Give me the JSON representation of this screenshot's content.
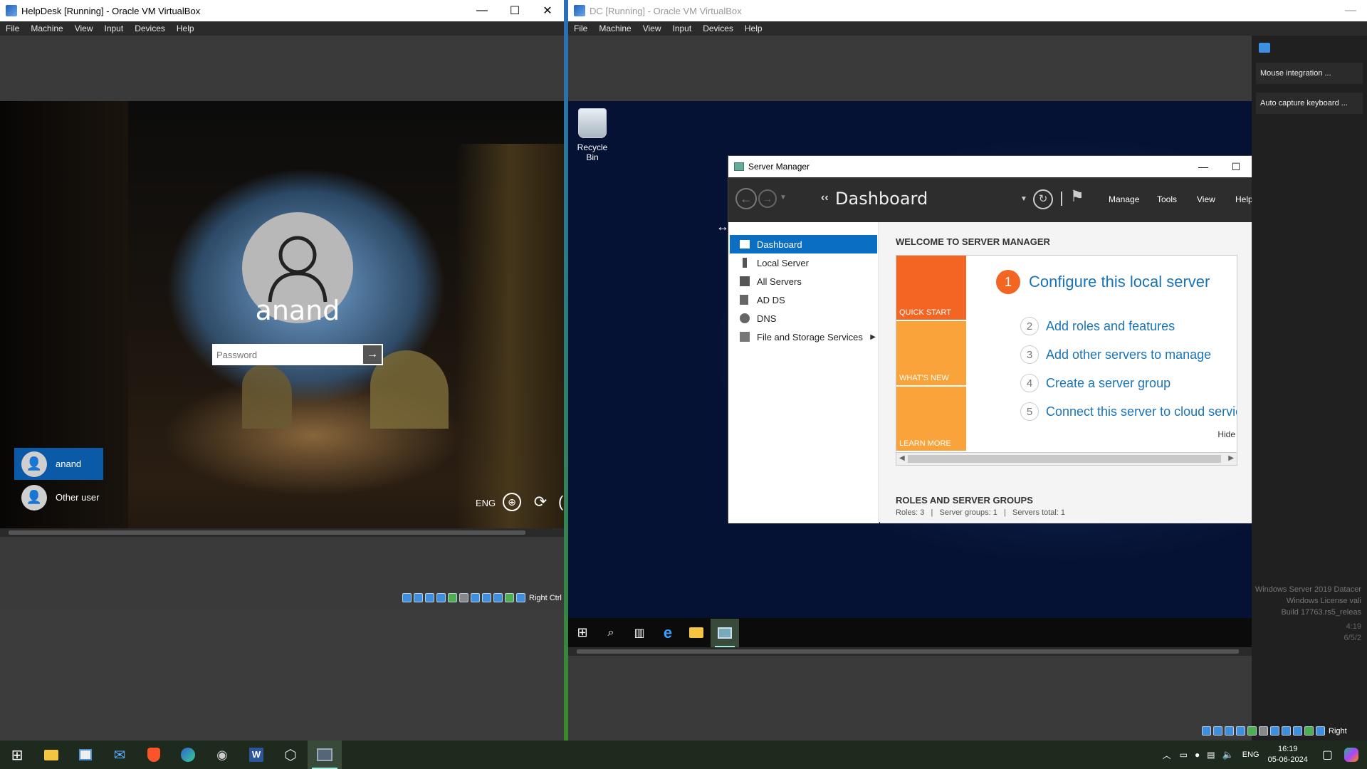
{
  "left_window": {
    "title": "HelpDesk [Running] - Oracle VM VirtualBox",
    "menu": [
      "File",
      "Machine",
      "Input",
      "View",
      "Devices",
      "Help"
    ],
    "menu_order": [
      "File",
      "Machine",
      "View",
      "Input",
      "Devices",
      "Help"
    ],
    "controls": {
      "minimize": "—",
      "maximize": "☐",
      "close": "✕"
    },
    "login": {
      "username": "anand",
      "password_placeholder": "Password",
      "users": [
        {
          "name": "anand",
          "selected": true
        },
        {
          "name": "Other user",
          "selected": false
        }
      ],
      "lang": "ENG"
    },
    "status_host_key": "Right Ctrl"
  },
  "right_window": {
    "title": "DC [Running] - Oracle VM VirtualBox",
    "menu": [
      "File",
      "Machine",
      "View",
      "Input",
      "Devices",
      "Help"
    ],
    "desktop": {
      "recycle_bin_label": "Recycle Bin",
      "watermark": [
        "Windows Server 2019 Datacer",
        "Windows License vali",
        "Build 17763.rs5_releas"
      ],
      "clock": [
        "4:19",
        "6/5/2"
      ]
    },
    "popup": {
      "items": [
        "Mouse integration ...",
        "Auto capture keyboard ..."
      ]
    },
    "server_manager": {
      "title": "Server Manager",
      "breadcrumb_arrows": "‹‹",
      "page_title": "Dashboard",
      "menus": [
        "Manage",
        "Tools",
        "View",
        "Help"
      ],
      "nav": [
        {
          "label": "Dashboard",
          "selected": true
        },
        {
          "label": "Local Server",
          "selected": false
        },
        {
          "label": "All Servers",
          "selected": false
        },
        {
          "label": "AD DS",
          "selected": false
        },
        {
          "label": "DNS",
          "selected": false
        },
        {
          "label": "File and Storage Services",
          "selected": false
        }
      ],
      "welcome_heading": "WELCOME TO SERVER MANAGER",
      "tiles": [
        "QUICK START",
        "WHAT'S NEW",
        "LEARN MORE"
      ],
      "configure": {
        "num": "1",
        "label": "Configure this local server"
      },
      "steps": [
        {
          "num": "2",
          "label": "Add roles and features"
        },
        {
          "num": "3",
          "label": "Add other servers to manage"
        },
        {
          "num": "4",
          "label": "Create a server group"
        },
        {
          "num": "5",
          "label": "Connect this server to cloud servic"
        }
      ],
      "hide_label": "Hide",
      "roles_heading": "ROLES AND SERVER GROUPS",
      "roles_summary": "Roles: 3   |   Server groups: 1   |   Servers total: 1"
    },
    "status_host_key": "Right"
  },
  "host_taskbar": {
    "lang": "ENG",
    "time": "16:19",
    "date": "05-06-2024"
  },
  "colors": {
    "sm_orange": "#f26522",
    "sm_light_orange": "#f9a33a",
    "sm_blue": "#0a6fc2",
    "sm_link": "#1874b8"
  }
}
